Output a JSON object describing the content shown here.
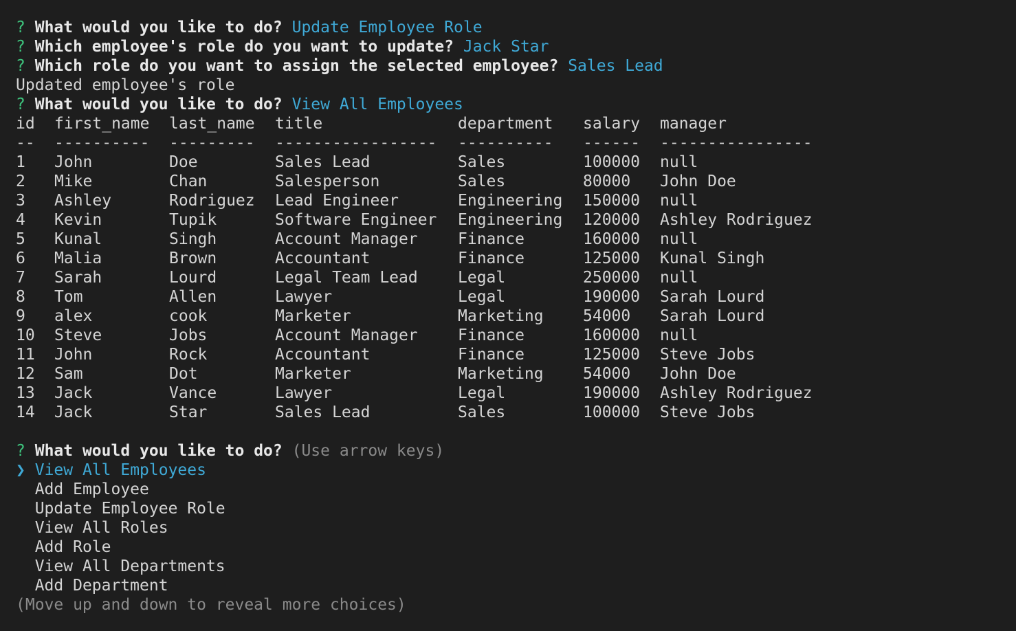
{
  "colors": {
    "background": "#1e1e1e",
    "question_mark": "#3ec47d",
    "answer": "#3fa9d6",
    "text": "#d4d4d4",
    "hint": "#8a8a8a"
  },
  "history": [
    {
      "mark": "?",
      "question": "What would you like to do?",
      "answer": "Update Employee Role"
    },
    {
      "mark": "?",
      "question": "Which employee's role do you want to update?",
      "answer": "Jack Star"
    },
    {
      "mark": "?",
      "question": "Which role do you want to assign the selected employee?",
      "answer": "Sales Lead"
    }
  ],
  "status_message": "Updated employee's role",
  "second_prompt": {
    "mark": "?",
    "question": "What would you like to do?",
    "answer": "View All Employees"
  },
  "table": {
    "headers": {
      "id": "id",
      "first_name": "first_name",
      "last_name": "last_name",
      "title": "title",
      "department": "department",
      "salary": "salary",
      "manager": "manager"
    },
    "separators": {
      "id": "--",
      "first_name": "----------",
      "last_name": "---------",
      "title": "-----------------",
      "department": "----------",
      "salary": "------",
      "manager": "----------------"
    },
    "rows": [
      {
        "id": "1",
        "first_name": "John",
        "last_name": "Doe",
        "title": "Sales Lead",
        "department": "Sales",
        "salary": "100000",
        "manager": "null"
      },
      {
        "id": "2",
        "first_name": "Mike",
        "last_name": "Chan",
        "title": "Salesperson",
        "department": "Sales",
        "salary": "80000",
        "manager": "John Doe"
      },
      {
        "id": "3",
        "first_name": "Ashley",
        "last_name": "Rodriguez",
        "title": "Lead Engineer",
        "department": "Engineering",
        "salary": "150000",
        "manager": "null"
      },
      {
        "id": "4",
        "first_name": "Kevin",
        "last_name": "Tupik",
        "title": "Software Engineer",
        "department": "Engineering",
        "salary": "120000",
        "manager": "Ashley Rodriguez"
      },
      {
        "id": "5",
        "first_name": "Kunal",
        "last_name": "Singh",
        "title": "Account Manager",
        "department": "Finance",
        "salary": "160000",
        "manager": "null"
      },
      {
        "id": "6",
        "first_name": "Malia",
        "last_name": "Brown",
        "title": "Accountant",
        "department": "Finance",
        "salary": "125000",
        "manager": "Kunal Singh"
      },
      {
        "id": "7",
        "first_name": "Sarah",
        "last_name": "Lourd",
        "title": "Legal Team Lead",
        "department": "Legal",
        "salary": "250000",
        "manager": "null"
      },
      {
        "id": "8",
        "first_name": "Tom",
        "last_name": "Allen",
        "title": "Lawyer",
        "department": "Legal",
        "salary": "190000",
        "manager": "Sarah Lourd"
      },
      {
        "id": "9",
        "first_name": "alex",
        "last_name": "cook",
        "title": "Marketer",
        "department": "Marketing",
        "salary": "54000",
        "manager": "Sarah Lourd"
      },
      {
        "id": "10",
        "first_name": "Steve",
        "last_name": "Jobs",
        "title": "Account Manager",
        "department": "Finance",
        "salary": "160000",
        "manager": "null"
      },
      {
        "id": "11",
        "first_name": "John",
        "last_name": "Rock",
        "title": "Accountant",
        "department": "Finance",
        "salary": "125000",
        "manager": "Steve Jobs"
      },
      {
        "id": "12",
        "first_name": "Sam",
        "last_name": "Dot",
        "title": "Marketer",
        "department": "Marketing",
        "salary": "54000",
        "manager": "John Doe"
      },
      {
        "id": "13",
        "first_name": "Jack",
        "last_name": "Vance",
        "title": "Lawyer",
        "department": "Legal",
        "salary": "190000",
        "manager": "Ashley Rodriguez"
      },
      {
        "id": "14",
        "first_name": "Jack",
        "last_name": "Star",
        "title": "Sales Lead",
        "department": "Sales",
        "salary": "100000",
        "manager": "Steve Jobs"
      }
    ]
  },
  "menu_prompt": {
    "mark": "?",
    "question": "What would you like to do?",
    "hint": "(Use arrow keys)",
    "pointer": "❯",
    "options": [
      "View All Employees",
      "Add Employee",
      "Update Employee Role",
      "View All Roles",
      "Add Role",
      "View All Departments",
      "Add Department"
    ],
    "footer_hint": "(Move up and down to reveal more choices)"
  }
}
